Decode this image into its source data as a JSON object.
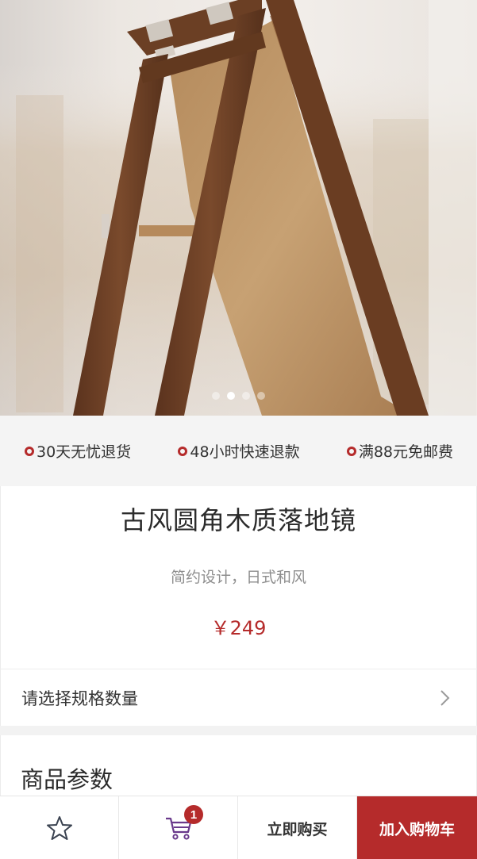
{
  "carousel": {
    "slide_count": 4,
    "active_slide": 2
  },
  "promises": [
    {
      "label": "30天无忧退货"
    },
    {
      "label": "48小时快速退款"
    },
    {
      "label": "满88元免邮费"
    }
  ],
  "product": {
    "title": "古风圆角木质落地镜",
    "subtitle": "简约设计，日式和风",
    "price": "￥249"
  },
  "spec": {
    "label": "请选择规格数量"
  },
  "params": {
    "title": "商品参数"
  },
  "bottom_bar": {
    "cart_count": "1",
    "buy_now_label": "立即购买",
    "add_to_cart_label": "加入购物车"
  },
  "colors": {
    "accent": "#b52b2b",
    "cart_icon": "#6a3a8c",
    "background_band": "#f4f4f4"
  },
  "icons": {
    "promise_marker": "ring-icon",
    "spec_arrow": "chevron-right-icon",
    "favorite": "star-icon",
    "cart": "cart-icon"
  }
}
